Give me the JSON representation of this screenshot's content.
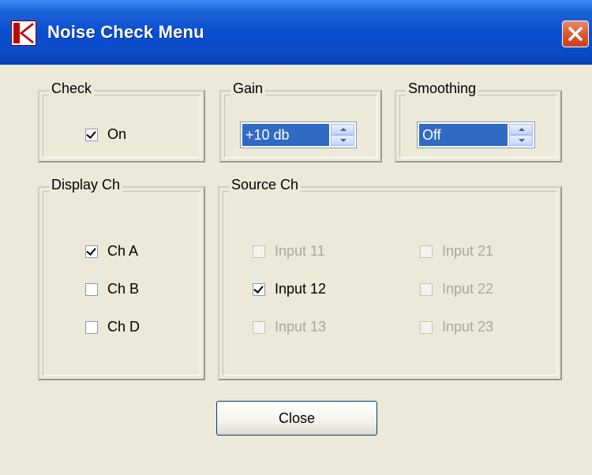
{
  "window": {
    "title": "Noise Check Menu",
    "close_glyph": "✕"
  },
  "check_group": {
    "label": "Check",
    "on_label": "On",
    "on_checked": true
  },
  "gain_group": {
    "label": "Gain",
    "value": "+10 db"
  },
  "smoothing_group": {
    "label": "Smoothing",
    "value": "Off"
  },
  "display_group": {
    "label": "Display Ch",
    "items": [
      {
        "label": "Ch A",
        "checked": true
      },
      {
        "label": "Ch B",
        "checked": false
      },
      {
        "label": "Ch D",
        "checked": false
      }
    ]
  },
  "source_group": {
    "label": "Source Ch",
    "items": [
      {
        "label": "Input 11",
        "checked": false,
        "enabled": false
      },
      {
        "label": "Input 12",
        "checked": true,
        "enabled": true
      },
      {
        "label": "Input 13",
        "checked": false,
        "enabled": false
      },
      {
        "label": "Input 21",
        "checked": false,
        "enabled": false
      },
      {
        "label": "Input 22",
        "checked": false,
        "enabled": false
      },
      {
        "label": "Input 23",
        "checked": false,
        "enabled": false
      }
    ]
  },
  "footer": {
    "close_label": "Close"
  },
  "colors": {
    "titlebar": "#0a4fd1",
    "selection": "#316ac5",
    "dialog_bg": "#ece9d8",
    "close_red": "#d95a32"
  }
}
